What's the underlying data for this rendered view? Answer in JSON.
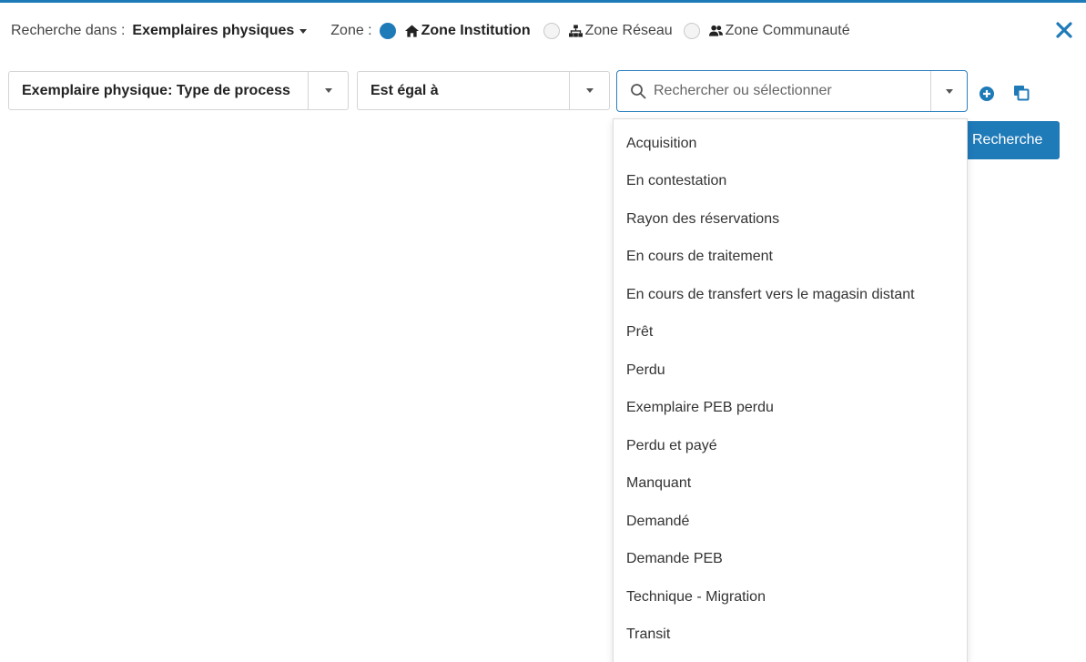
{
  "topbar": {
    "search_in_label": "Recherche dans :",
    "scope_label": "Exemplaires physiques",
    "zone_label": "Zone :",
    "zones": [
      {
        "label": "Zone Institution",
        "selected": true,
        "icon": "home-icon"
      },
      {
        "label": "Zone Réseau",
        "selected": false,
        "icon": "network-icon"
      },
      {
        "label": "Zone Communauté",
        "selected": false,
        "icon": "users-icon"
      }
    ]
  },
  "filter": {
    "field_label": "Exemplaire physique: Type de process",
    "operator_label": "Est égal à",
    "value_placeholder": "Rechercher ou sélectionner"
  },
  "search_button_label": "Recherche",
  "dropdown": {
    "options": [
      "Acquisition",
      "En contestation",
      "Rayon des réservations",
      "En cours de traitement",
      "En cours de transfert vers le magasin distant",
      "Prêt",
      "Perdu",
      "Exemplaire PEB perdu",
      "Perdu et payé",
      "Manquant",
      "Demandé",
      "Demande PEB",
      "Technique - Migration",
      "Transit"
    ]
  },
  "colors": {
    "accent": "#1f7ab8",
    "border": "#d4d4d4",
    "text": "#333333"
  }
}
